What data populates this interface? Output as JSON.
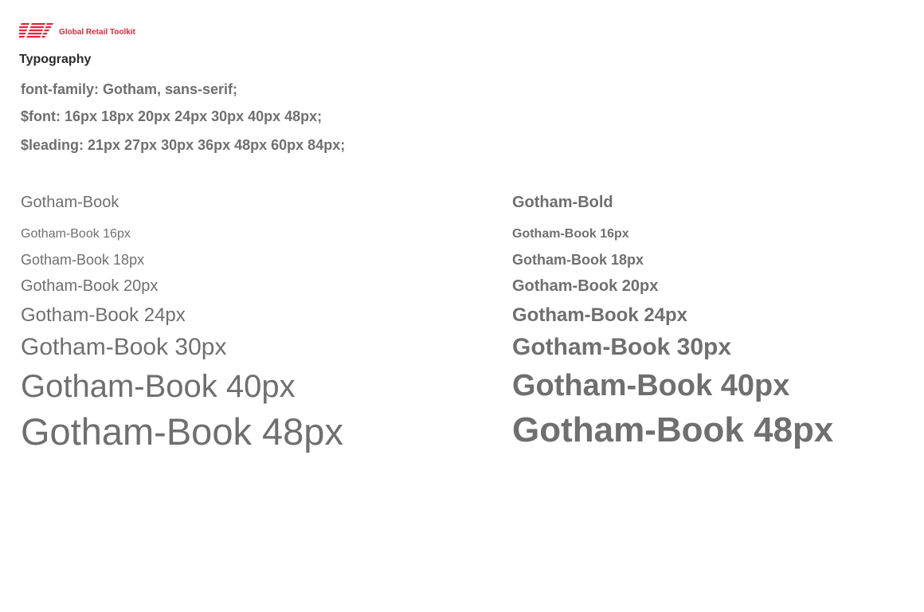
{
  "brand": {
    "logo_icon": "new-balance-nb-logo",
    "toolkit_label": "Global Retail Toolkit",
    "accent_color": "#e2253d"
  },
  "page": {
    "title": "Typography"
  },
  "specs": {
    "font_family": "font-family: Gotham, sans-serif;",
    "font_sizes": "$font: 16px 18px 20px 24px 30px 40px 48px;",
    "leading": "$leading: 21px 27px 30px 36px 48px 60px 84px;"
  },
  "columns": {
    "book": {
      "heading": "Gotham-Book",
      "samples": [
        "Gotham-Book 16px",
        "Gotham-Book 18px",
        "Gotham-Book 20px",
        "Gotham-Book 24px",
        "Gotham-Book 30px",
        "Gotham-Book 40px",
        "Gotham-Book 48px"
      ]
    },
    "bold": {
      "heading": "Gotham-Bold",
      "samples": [
        "Gotham-Book 16px",
        "Gotham-Book 18px",
        "Gotham-Book 20px",
        "Gotham-Book 24px",
        "Gotham-Book 30px",
        "Gotham-Book 40px",
        "Gotham-Book 48px"
      ]
    }
  },
  "colors": {
    "text_gray": "#6f6f6f",
    "title_dark": "#2b2b2b"
  }
}
